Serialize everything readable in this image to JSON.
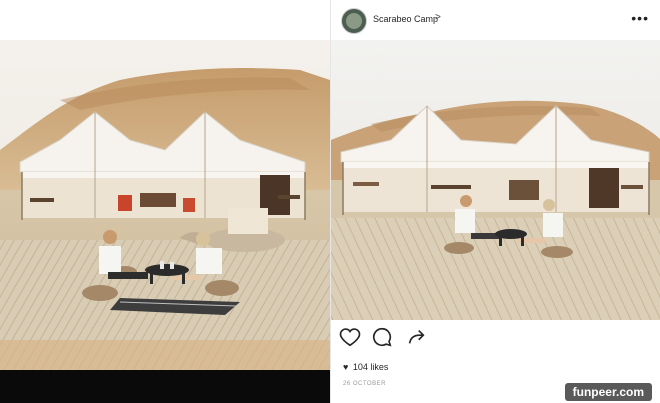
{
  "post": {
    "account_name": "Scarabeo Camp",
    "chevron": ">",
    "more": "•••",
    "likes_label": "104 likes",
    "date": "26 OCTOBER"
  },
  "watermark": "funpeer.com",
  "icons": {
    "avatar": "avatar-photo",
    "more": "more-options-icon",
    "like": "heart-outline-icon",
    "comment": "comment-bubble-icon",
    "share": "share-arrow-icon",
    "likes_heart": "heart-filled-icon"
  },
  "colors": {
    "sand": "#d9c6a8",
    "dune": "#c9a47a",
    "tent": "#f3efe8",
    "sky": "#f0ede8",
    "rug": "#d8cbb3",
    "bar": "#0a0a0a"
  }
}
